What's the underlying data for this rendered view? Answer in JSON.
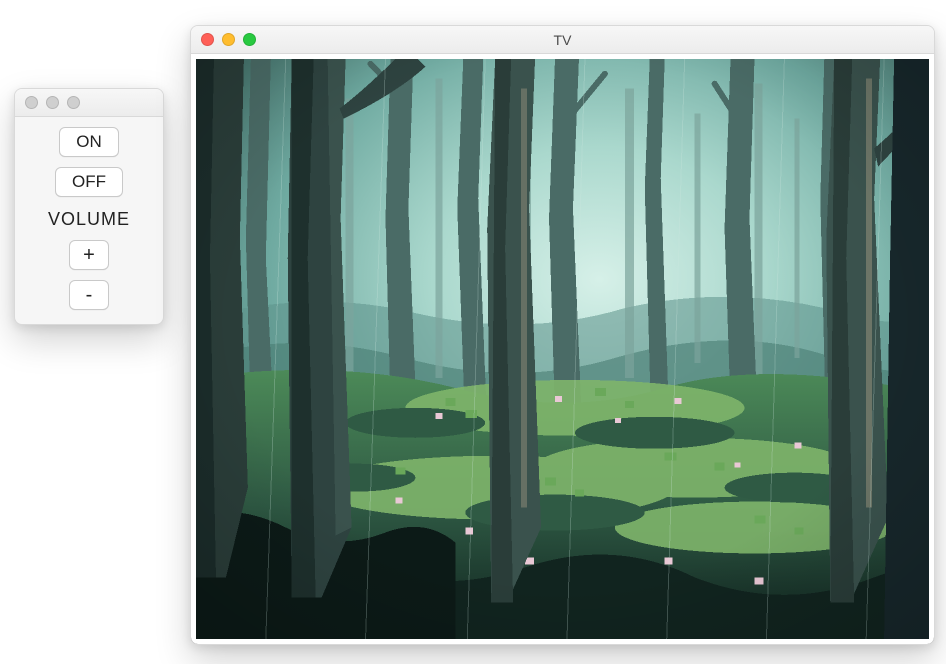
{
  "tv": {
    "title": "TV",
    "traffic_active": true
  },
  "remote": {
    "title": "",
    "traffic_active": false,
    "on_label": "ON",
    "off_label": "OFF",
    "volume_label": "VOLUME",
    "vol_up_label": "+",
    "vol_down_label": "-"
  },
  "scene": {
    "name": "forest-pixel-art",
    "palette": {
      "sky_far": "#b9e2d8",
      "sky_mid": "#8fc7bd",
      "fog": "#6ea9a0",
      "tree_far": "#6a8c88",
      "tree_mid": "#4a6b66",
      "tree_near": "#2e4340",
      "tree_dark": "#1b2c2a",
      "bark_light": "#b9a98e",
      "bark_mid": "#6e6452",
      "grass_light": "#7fb56b",
      "grass_mid": "#4c8a58",
      "grass_dark": "#2f5a44",
      "ground_dark": "#17302b",
      "flower": "#e9c8d5"
    }
  }
}
